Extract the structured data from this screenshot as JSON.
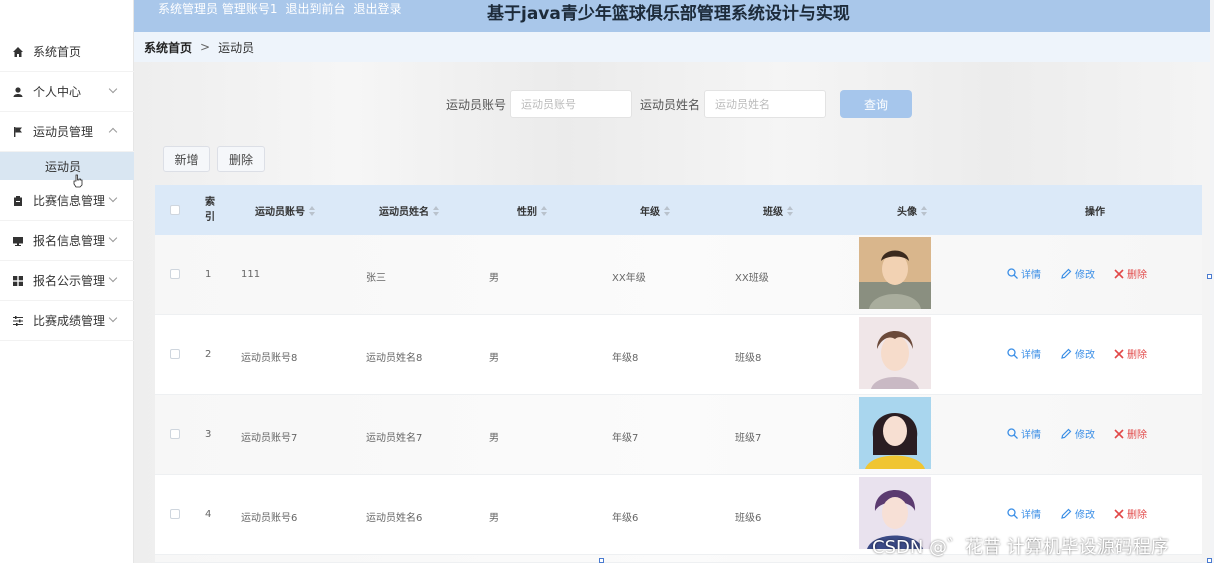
{
  "header": {
    "links": [
      "系统管理员 管理账号1",
      "退出到前台",
      "退出登录"
    ],
    "title": "基于java青少年篮球俱乐部管理系统设计与实现"
  },
  "sidebar": {
    "items": [
      {
        "label": "系统首页",
        "icon": "home-icon"
      },
      {
        "label": "个人中心",
        "icon": "user-icon"
      },
      {
        "label": "运动员管理",
        "icon": "flag-icon"
      },
      {
        "label": "比赛信息管理",
        "icon": "clipboard-icon"
      },
      {
        "label": "报名信息管理",
        "icon": "monitor-icon"
      },
      {
        "label": "报名公示管理",
        "icon": "grid-icon"
      },
      {
        "label": "比赛成绩管理",
        "icon": "sliders-icon"
      }
    ],
    "sub_item": "运动员"
  },
  "breadcrumb": {
    "home": "系统首页",
    "separator": ">",
    "current": "运动员"
  },
  "search": {
    "account_label": "运动员账号",
    "account_placeholder": "运动员账号",
    "name_label": "运动员姓名",
    "name_placeholder": "运动员姓名",
    "query_button": "查询"
  },
  "actions": {
    "add": "新增",
    "delete": "删除"
  },
  "table": {
    "headers": {
      "index": "索引",
      "account": "运动员账号",
      "name": "运动员姓名",
      "gender": "性别",
      "grade": "年级",
      "class": "班级",
      "avatar": "头像",
      "ops": "操作"
    },
    "ops": {
      "detail": "详情",
      "edit": "修改",
      "delete": "删除"
    },
    "rows": [
      {
        "index": "1",
        "account": "111",
        "name": "张三",
        "gender": "男",
        "grade": "XX年级",
        "class": "XX班级"
      },
      {
        "index": "2",
        "account": "运动员账号8",
        "name": "运动员姓名8",
        "gender": "男",
        "grade": "年级8",
        "class": "班级8"
      },
      {
        "index": "3",
        "account": "运动员账号7",
        "name": "运动员姓名7",
        "gender": "男",
        "grade": "年级7",
        "class": "班级7"
      },
      {
        "index": "4",
        "account": "运动员账号6",
        "name": "运动员姓名6",
        "gender": "男",
        "grade": "年级6",
        "class": "班级6"
      }
    ]
  },
  "watermark": "CSDN @゛花昔  计算机毕设源码程序",
  "colors": {
    "header_bg": "#a9c7ea",
    "table_head_bg": "#dbe9f8",
    "link_blue": "#3a8ee6",
    "delete_red": "#e24848"
  }
}
